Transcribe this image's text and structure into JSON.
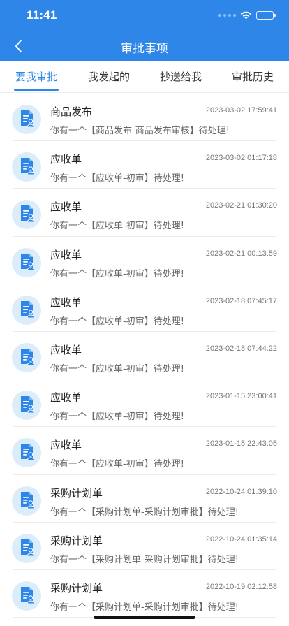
{
  "status_bar": {
    "time": "11:41"
  },
  "header": {
    "title": "审批事项",
    "back_icon": "chevron-left-icon"
  },
  "colors": {
    "brand": "#2f86e9",
    "avatar_bg": "#dbedfb",
    "icon_blue": "#2f86e9"
  },
  "tabs": [
    {
      "label": "要我审批",
      "active": true
    },
    {
      "label": "我发起的",
      "active": false
    },
    {
      "label": "抄送给我",
      "active": false
    },
    {
      "label": "审批历史",
      "active": false
    }
  ],
  "items": [
    {
      "title": "商品发布",
      "date": "2023-03-02 17:59:41",
      "message": "你有一个【商品发布-商品发布审核】待处理!",
      "icon": "approval-document-icon"
    },
    {
      "title": "应收单",
      "date": "2023-03-02 01:17:18",
      "message": "你有一个【应收单-初审】待处理!",
      "icon": "approval-document-icon"
    },
    {
      "title": "应收单",
      "date": "2023-02-21 01:30:20",
      "message": "你有一个【应收单-初审】待处理!",
      "icon": "approval-document-icon"
    },
    {
      "title": "应收单",
      "date": "2023-02-21 00:13:59",
      "message": "你有一个【应收单-初审】待处理!",
      "icon": "approval-document-icon"
    },
    {
      "title": "应收单",
      "date": "2023-02-18 07:45:17",
      "message": "你有一个【应收单-初审】待处理!",
      "icon": "approval-document-icon"
    },
    {
      "title": "应收单",
      "date": "2023-02-18 07:44:22",
      "message": "你有一个【应收单-初审】待处理!",
      "icon": "approval-document-icon"
    },
    {
      "title": "应收单",
      "date": "2023-01-15 23:00:41",
      "message": "你有一个【应收单-初审】待处理!",
      "icon": "approval-document-icon"
    },
    {
      "title": "应收单",
      "date": "2023-01-15 22:43:05",
      "message": "你有一个【应收单-初审】待处理!",
      "icon": "approval-document-icon"
    },
    {
      "title": "采购计划单",
      "date": "2022-10-24 01:39:10",
      "message": "你有一个【采购计划单-采购计划审批】待处理!",
      "icon": "approval-document-icon"
    },
    {
      "title": "采购计划单",
      "date": "2022-10-24 01:35:14",
      "message": "你有一个【采购计划单-采购计划审批】待处理!",
      "icon": "approval-document-icon"
    },
    {
      "title": "采购计划单",
      "date": "2022-10-19 02:12:58",
      "message": "你有一个【采购计划单-采购计划审批】待处理!",
      "icon": "approval-document-icon"
    }
  ]
}
